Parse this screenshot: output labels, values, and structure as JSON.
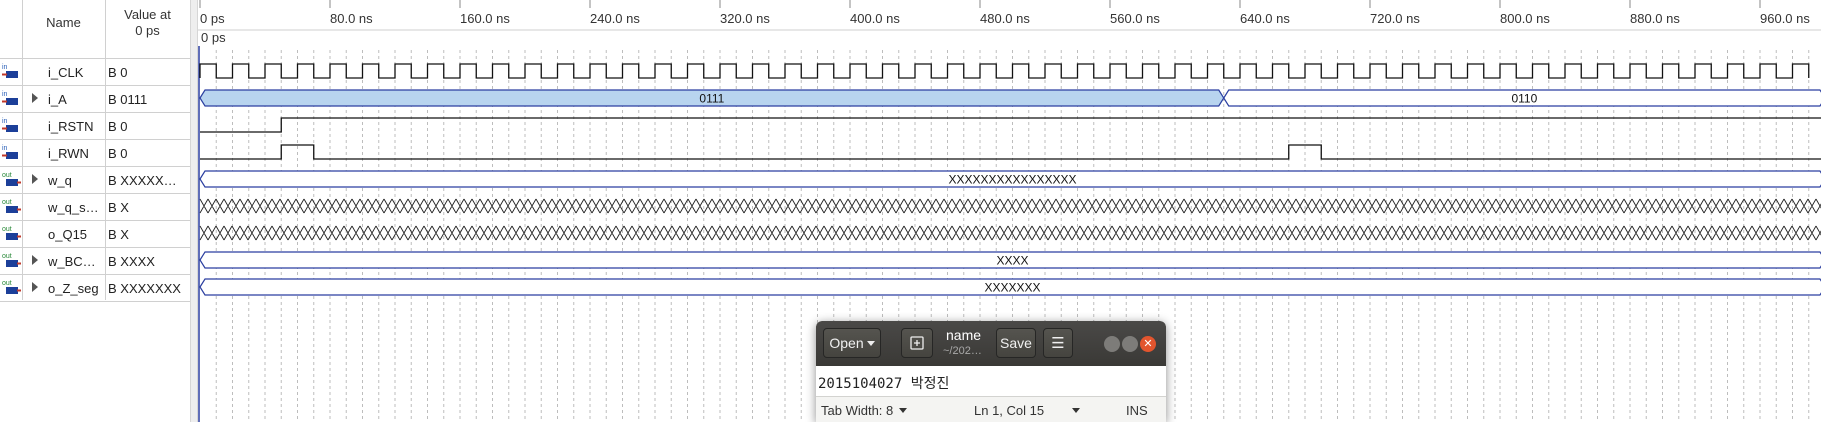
{
  "signal_list": {
    "name_header": "Name",
    "value_header": "Value at\n0 ps",
    "rows": [
      {
        "dir": "in",
        "expandable": false,
        "name": "i_CLK",
        "value": "B 0"
      },
      {
        "dir": "in",
        "expandable": true,
        "name": "i_A",
        "value": "B 0111"
      },
      {
        "dir": "in",
        "expandable": false,
        "name": "i_RSTN",
        "value": "B 0"
      },
      {
        "dir": "in",
        "expandable": false,
        "name": "i_RWN",
        "value": "B 0"
      },
      {
        "dir": "out",
        "expandable": true,
        "name": "w_q",
        "value": "B XXXXX…"
      },
      {
        "dir": "out",
        "expandable": false,
        "name": "w_q_s…",
        "value": "B X"
      },
      {
        "dir": "out",
        "expandable": false,
        "name": "o_Q15",
        "value": "B X"
      },
      {
        "dir": "out",
        "expandable": true,
        "name": "w_BC…",
        "value": "B XXXX"
      },
      {
        "dir": "out",
        "expandable": true,
        "name": "o_Z_seg",
        "value": "B XXXXXXX"
      }
    ]
  },
  "timeline": {
    "ticks": [
      "0 ps",
      "80.0 ns",
      "160.0 ns",
      "240.0 ns",
      "320.0 ns",
      "400.0 ns",
      "480.0 ns",
      "560.0 ns",
      "640.0 ns",
      "720.0 ns",
      "800.0 ns",
      "880.0 ns",
      "960.0 ns"
    ],
    "cursor_label": "0 ps",
    "ns_per_major_tick": 80
  },
  "waveforms": {
    "i_CLK_period_ns": 20,
    "i_A": [
      {
        "from_ns": 0,
        "to_ns": 630,
        "label": "0111"
      },
      {
        "from_ns": 630,
        "to_ns": 1000,
        "label": "0110"
      }
    ],
    "i_RSTN_rise_ns": 50,
    "i_RWN_pulses_ns": [
      [
        50,
        70
      ],
      [
        670,
        690
      ]
    ],
    "w_q_label": "XXXXXXXXXXXXXXXX",
    "w_BCD_label": "XXXX",
    "o_Z_seg_label": "XXXXXXX"
  },
  "colors": {
    "bus_highlight": "#b8d4ef",
    "bus_border": "#2b3fa0",
    "wave_line": "#111111",
    "grid_dash": "#bdbdbd"
  },
  "gedit": {
    "open_label": "Open",
    "save_label": "Save",
    "doc_title": "name",
    "doc_path": "~/202…",
    "content": "2015104027 박정진",
    "tab_width": "Tab Width: 8",
    "cursor_pos": "Ln 1, Col 15",
    "mode": "INS"
  }
}
